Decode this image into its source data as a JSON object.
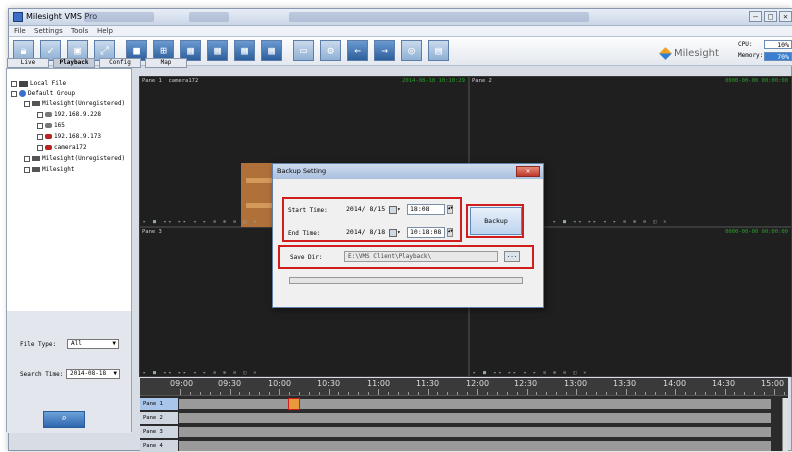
{
  "app": {
    "title": "Milesight VMS Pro"
  },
  "window_controls": {
    "minimize": "–",
    "maximize": "□",
    "close": "✕"
  },
  "menu": [
    "File",
    "Settings",
    "Tools",
    "Help"
  ],
  "toolbar": {
    "icons": [
      "lock-icon",
      "check-icon",
      "screen-icon",
      "fullscreen-icon",
      "layout-1-icon",
      "layout-4-icon",
      "layout-6-icon",
      "layout-9-icon",
      "layout-13-icon",
      "layout-16-icon",
      "layout-custom-icon",
      "settings-icon",
      "arrow-left-icon",
      "arrow-right-icon",
      "screenshot-icon",
      "record-icon"
    ],
    "brand": "Milesight",
    "cpu_label": "CPU:",
    "cpu_value": "10%",
    "memory_label": "Memory:",
    "memory_value": "70%"
  },
  "tabs": [
    "Live",
    "Playback",
    "Config",
    "Map"
  ],
  "tree": {
    "local_file": "Local File",
    "default_group": "Default Group",
    "items": [
      "Milesight(Unregistered)",
      "192.168.9.228",
      "165",
      "192.168.9.173",
      "camera172",
      "Milesight(Unregistered)",
      "Milesight"
    ]
  },
  "filters": {
    "file_type_label": "File Type:",
    "file_type_value": "All",
    "search_time_label": "Search Time:",
    "search_time_value": "2014-08-18",
    "search_button": "⌕"
  },
  "panes": {
    "p1_name": "Pane 1",
    "p1_camera": "camera172",
    "p1_time": "2014-08-18 10:10:29",
    "p2_name": "Pane 2",
    "p2_time": "0000-00-00 00:00:00",
    "p3_name": "Pane 3",
    "p4_time": "0000-00-00 00:00:00",
    "controls": "▸ ■ ◂◂ ▸▸ ◂ ▸ ⊘ ⊕ ⊖ ◫ ✕"
  },
  "dialog": {
    "title": "Backup Setting",
    "close": "✕",
    "start_label": "Start Time:",
    "start_date": "2014/ 8/15",
    "start_time": "18:08",
    "end_label": "End Time:",
    "end_date": "2014/ 8/18",
    "end_time": "10:18:08",
    "backup_button": "Backup",
    "save_dir_label": "Save Dir:",
    "save_dir_value": "E:\\VMS Client\\Playback\\",
    "browse_button": "..."
  },
  "timeline": {
    "hours": [
      "09:00",
      "09:30",
      "10:00",
      "10:30",
      "11:00",
      "11:30",
      "12:00",
      "12:30",
      "13:00",
      "13:30",
      "14:00",
      "14:30",
      "15:00"
    ],
    "rows": [
      "Pane 1",
      "Pane 2",
      "Pane 3",
      "Pane 4"
    ]
  }
}
